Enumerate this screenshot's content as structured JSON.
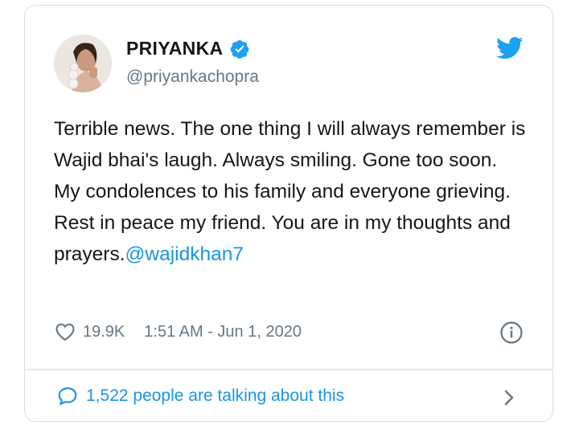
{
  "tweet": {
    "author_name": "PRIYANKA",
    "author_handle": "@priyankachopra",
    "text": "Terrible news. The one thing I will always remember is Wajid bhai's laugh. Always smiling. Gone too soon. My condolences to his family and everyone grieving. Rest in peace my friend. You are in my thoughts and prayers.",
    "mention": "@wajidkhan7",
    "likes": "19.9K",
    "timestamp": "1:51 AM - Jun 1, 2020",
    "talking_text": "1,522 people are talking about this"
  },
  "icons": {
    "verified": "verified-badge-icon",
    "brand": "twitter-bird-icon",
    "like": "heart-icon",
    "info": "info-icon",
    "conversation": "speech-bubble-icon",
    "more": "chevron-right-icon"
  },
  "colors": {
    "accent": "#1b95e0",
    "twitter_blue": "#1da1f2",
    "muted_text": "#657786",
    "primary_text": "#14171a",
    "border": "#d8dee2"
  }
}
